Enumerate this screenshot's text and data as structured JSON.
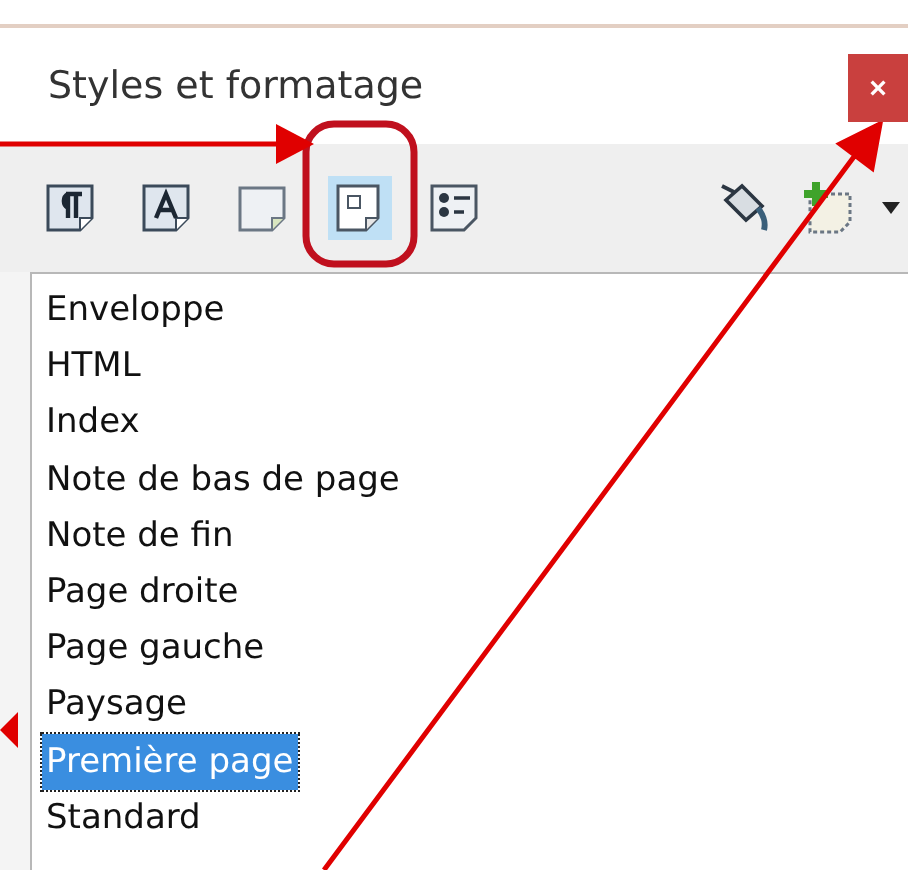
{
  "panel": {
    "title": "Styles et formatage",
    "close_label": "×"
  },
  "categories": [
    {
      "kind": "paragraph",
      "selected": false
    },
    {
      "kind": "character",
      "selected": false
    },
    {
      "kind": "frame",
      "selected": false
    },
    {
      "kind": "page",
      "selected": true
    },
    {
      "kind": "list",
      "selected": false
    }
  ],
  "actions": [
    {
      "kind": "fill"
    },
    {
      "kind": "new"
    },
    {
      "kind": "menu"
    }
  ],
  "styles": [
    {
      "label": "Enveloppe",
      "selected": false
    },
    {
      "label": "HTML",
      "selected": false
    },
    {
      "label": "Index",
      "selected": false
    },
    {
      "label": "Note de bas de page",
      "selected": false
    },
    {
      "label": "Note de fin",
      "selected": false
    },
    {
      "label": "Page droite",
      "selected": false
    },
    {
      "label": "Page gauche",
      "selected": false
    },
    {
      "label": "Paysage",
      "selected": false
    },
    {
      "label": "Première page",
      "selected": true
    },
    {
      "label": "Standard",
      "selected": false
    }
  ]
}
